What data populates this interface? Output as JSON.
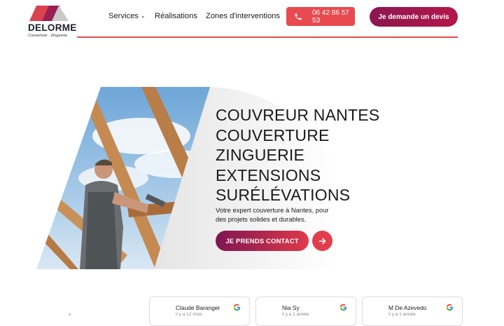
{
  "brand": {
    "name": "DELORME",
    "tagline": "Couverture · Zinguerie",
    "colors": {
      "accent": "#e84a4f",
      "dark": "#8c1650",
      "text": "#1b1b1b"
    }
  },
  "nav": {
    "items": [
      {
        "label": "Services",
        "has_dropdown": true
      },
      {
        "label": "Réalisations",
        "has_dropdown": false
      },
      {
        "label": "Zones d'interventions",
        "has_dropdown": false
      }
    ],
    "phone": {
      "icon": "phone-icon",
      "label": "06 42 86 57 53"
    },
    "quote_label": "Je demande un devis"
  },
  "hero": {
    "title_lines": [
      "COUVREUR NANTES",
      "COUVERTURE",
      "ZINGUERIE",
      "EXTENSIONS",
      "SURÉLÉVATIONS"
    ],
    "description": "Votre expert couverture à Nantes, pour des projets solides et durables.",
    "cta_label": "JE PRENDS CONTACT",
    "cta_icon": "arrow-right-icon"
  },
  "reviews": [
    {
      "name": "Claude Baranger",
      "date": "il y a 12 mois",
      "source_icon": "google-icon"
    },
    {
      "name": "Nia Sy",
      "date": "il y a 1 année",
      "source_icon": "google-icon"
    },
    {
      "name": "M De Azevedo",
      "date": "il y a 1 année",
      "source_icon": "google-icon"
    }
  ]
}
